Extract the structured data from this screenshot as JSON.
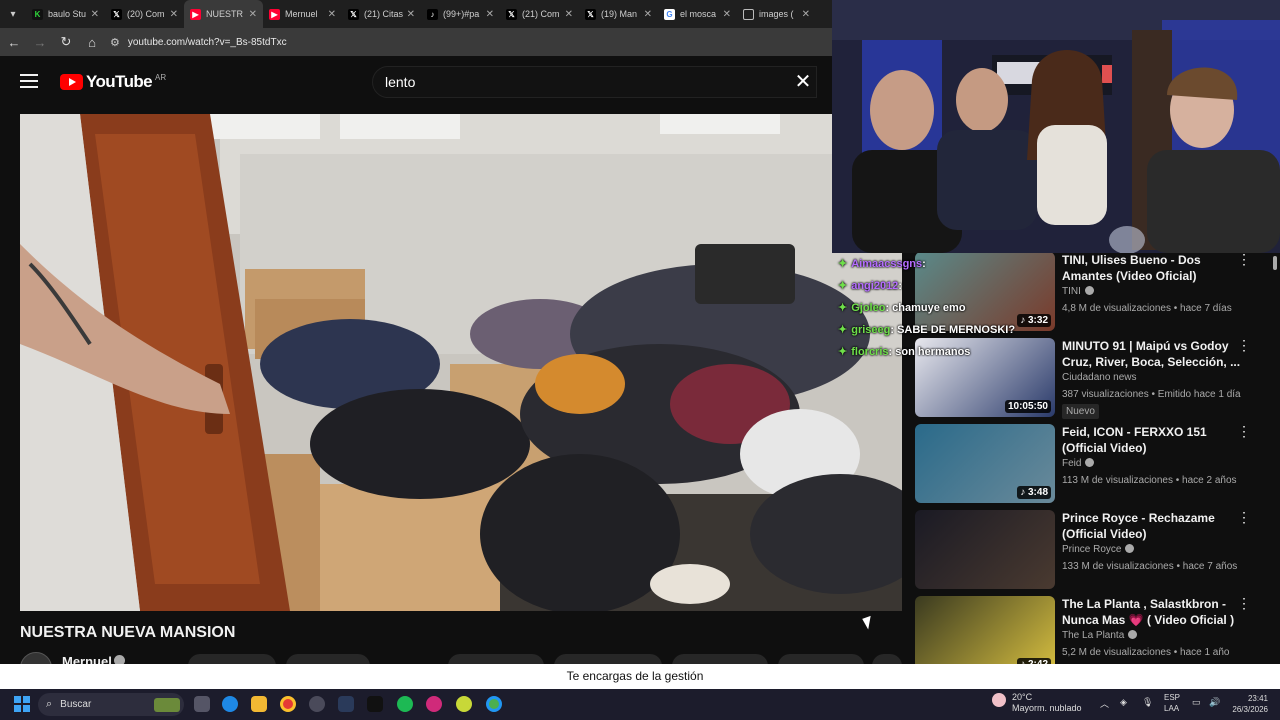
{
  "browser": {
    "tabs": [
      {
        "title": "baulo Stu",
        "favicon": "kick-icon",
        "active": false
      },
      {
        "title": "(20) Com",
        "favicon": "x-icon",
        "active": false
      },
      {
        "title": "NUESTR",
        "favicon": "youtube-icon",
        "active": true
      },
      {
        "title": "Mernuel",
        "favicon": "youtube-icon",
        "active": false
      },
      {
        "title": "(21) Citas",
        "favicon": "x-icon",
        "active": false
      },
      {
        "title": "(99+)#pa",
        "favicon": "tiktok-icon",
        "active": false
      },
      {
        "title": "(21) Com",
        "favicon": "x-icon",
        "active": false
      },
      {
        "title": "(19) Man",
        "favicon": "x-icon",
        "active": false
      },
      {
        "title": "el mosca",
        "favicon": "google-icon",
        "active": false
      },
      {
        "title": "images (",
        "favicon": "globe-icon",
        "active": false
      }
    ],
    "url": "youtube.com/watch?v=_Bs-85tdTxc"
  },
  "youtube": {
    "logo_text": "YouTube",
    "country_code": "AR",
    "search_value": "lento",
    "video_title": "NUESTRA NUEVA MANSION",
    "channel_name": "Mernuel"
  },
  "chat": [
    {
      "user": "Aimaacssgns",
      "msg": ":",
      "color": "purple"
    },
    {
      "user": "angi2012",
      "msg": ":",
      "color": "purple"
    },
    {
      "user": "Gjoleo",
      "msg": ": chamuye emo",
      "color": "green"
    },
    {
      "user": "griseeg",
      "msg": ": SABE DE MERNOSKI?",
      "color": "green"
    },
    {
      "user": "florcris",
      "msg": ": son hermanos",
      "color": "green"
    }
  ],
  "recommendations": [
    {
      "title": "TINI, Ulises Bueno - Dos Amantes (Video Oficial)",
      "channel": "TINI",
      "verified": true,
      "meta": "4,8 M de visualizaciones • hace 7 días",
      "duration": "3:32",
      "music": true,
      "badge": ""
    },
    {
      "title": "MINUTO 91 | Maipú vs Godoy Cruz, River, Boca, Selección, ...",
      "channel": "Ciudadano news",
      "verified": false,
      "meta": "387 visualizaciones • Emitido hace 1 día",
      "duration": "10:05:50",
      "music": false,
      "badge": "Nuevo"
    },
    {
      "title": "Feid, ICON - FERXXO 151 (Official Video)",
      "channel": "Feid",
      "verified": true,
      "meta": "113 M de visualizaciones • hace 2 años",
      "duration": "3:48",
      "music": true,
      "badge": ""
    },
    {
      "title": "Prince Royce - Rechazame (Official Video)",
      "channel": "Prince Royce",
      "verified": true,
      "meta": "133 M de visualizaciones • hace 7 años",
      "duration": "",
      "music": false,
      "badge": ""
    },
    {
      "title": "The La Planta , Salastkbron - Nunca Mas 💗 ( Video Oficial )",
      "channel": "The La Planta",
      "verified": true,
      "meta": "5,2 M de visualizaciones • hace 1 año",
      "duration": "2:42",
      "music": true,
      "badge": ""
    }
  ],
  "subtitle": "Te encargas de la gestión",
  "taskbar": {
    "search_label": "Buscar",
    "weather_temp": "20°C",
    "weather_desc": "Mayorm. nublado",
    "lang_top": "ESP",
    "lang_bottom": "LAA",
    "time": "23:41",
    "date": "26/3/2026"
  }
}
